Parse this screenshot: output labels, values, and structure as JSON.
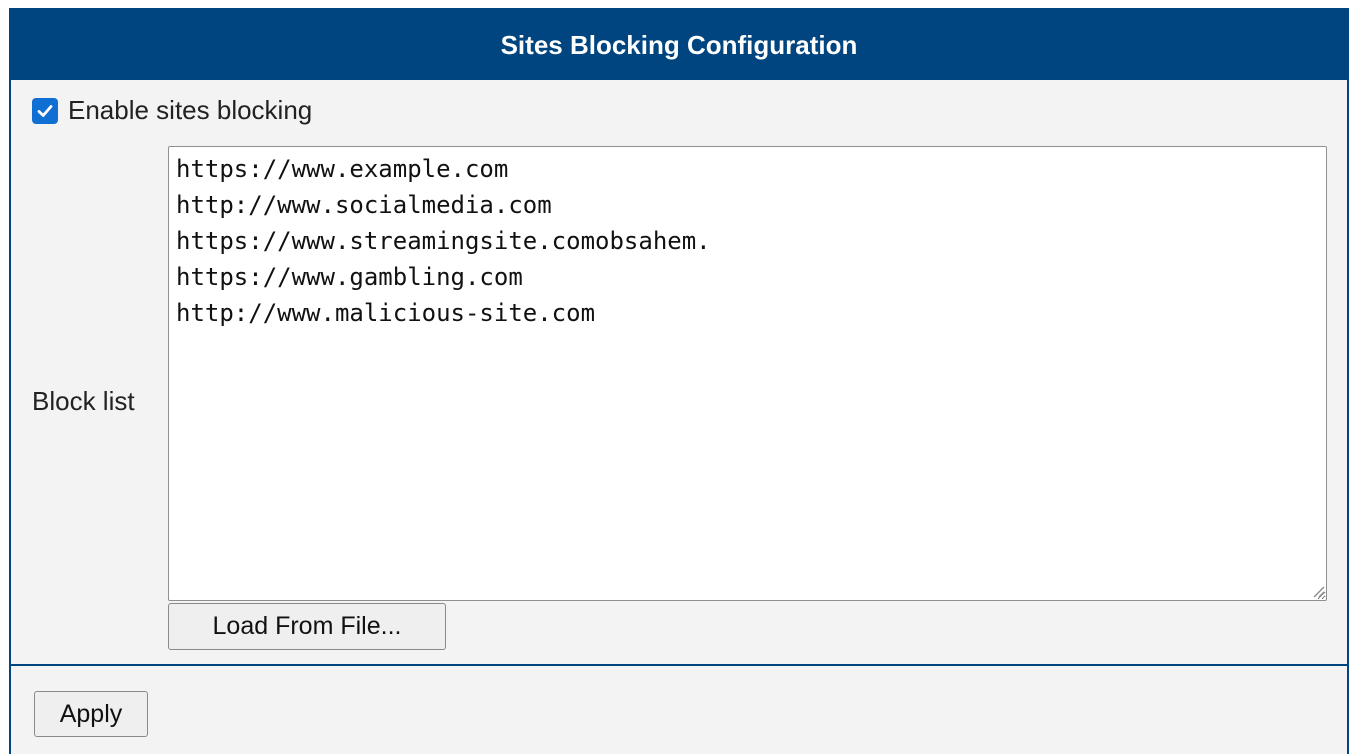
{
  "panel": {
    "title": "Sites Blocking Configuration",
    "accent_color": "#00457f"
  },
  "enable": {
    "label": "Enable sites blocking",
    "checked": true,
    "checkbox_color": "#0f6fd3",
    "icon": "checkmark-icon"
  },
  "block_list": {
    "label": "Block list",
    "value": "https://www.example.com\nhttp://www.socialmedia.com\nhttps://www.streamingsite.comobsahem.\nhttps://www.gambling.com\nhttp://www.malicious-site.com",
    "resize_icon": "resize-grip-icon"
  },
  "buttons": {
    "load_from_file": "Load From File...",
    "apply": "Apply"
  }
}
